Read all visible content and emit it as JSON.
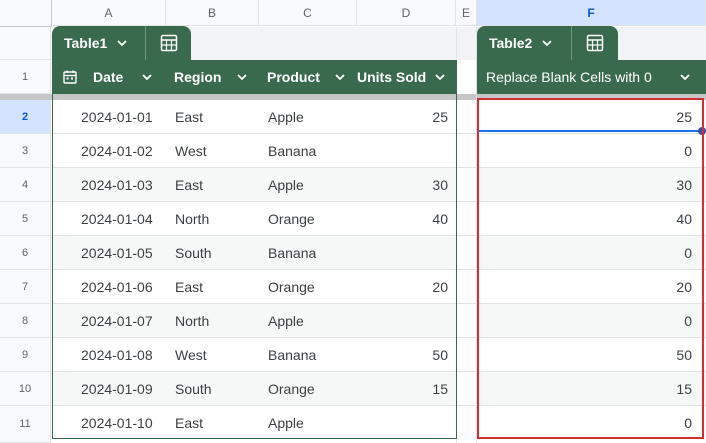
{
  "columns": [
    "A",
    "B",
    "C",
    "D",
    "E",
    "F"
  ],
  "rows": [
    "1",
    "2",
    "3",
    "4",
    "5",
    "6",
    "7",
    "8",
    "9",
    "10",
    "11"
  ],
  "table1": {
    "name": "Table1",
    "headers": [
      "Date",
      "Region",
      "Product",
      "Units Sold"
    ],
    "data": [
      [
        "2024-01-01",
        "East",
        "Apple",
        "25"
      ],
      [
        "2024-01-02",
        "West",
        "Banana",
        ""
      ],
      [
        "2024-01-03",
        "East",
        "Apple",
        "30"
      ],
      [
        "2024-01-04",
        "North",
        "Orange",
        "40"
      ],
      [
        "2024-01-05",
        "South",
        "Banana",
        ""
      ],
      [
        "2024-01-06",
        "East",
        "Orange",
        "20"
      ],
      [
        "2024-01-07",
        "North",
        "Apple",
        ""
      ],
      [
        "2024-01-08",
        "West",
        "Banana",
        "50"
      ],
      [
        "2024-01-09",
        "South",
        "Orange",
        "15"
      ],
      [
        "2024-01-10",
        "East",
        "Apple",
        ""
      ]
    ]
  },
  "table2": {
    "name": "Table2",
    "header": "Replace Blank Cells with 0",
    "values": [
      "25",
      "0",
      "30",
      "40",
      "0",
      "20",
      "0",
      "50",
      "15",
      "0"
    ]
  },
  "selected_column": "F",
  "selected_row": "2",
  "colors": {
    "table_header": "#3a6a4d",
    "highlight_border": "#d32f2f",
    "selection": "#1a73e8"
  },
  "icons": {
    "table_tool": "table-calc-icon",
    "date_header": "calendar-icon",
    "dropdown": "chevron-down-icon"
  }
}
